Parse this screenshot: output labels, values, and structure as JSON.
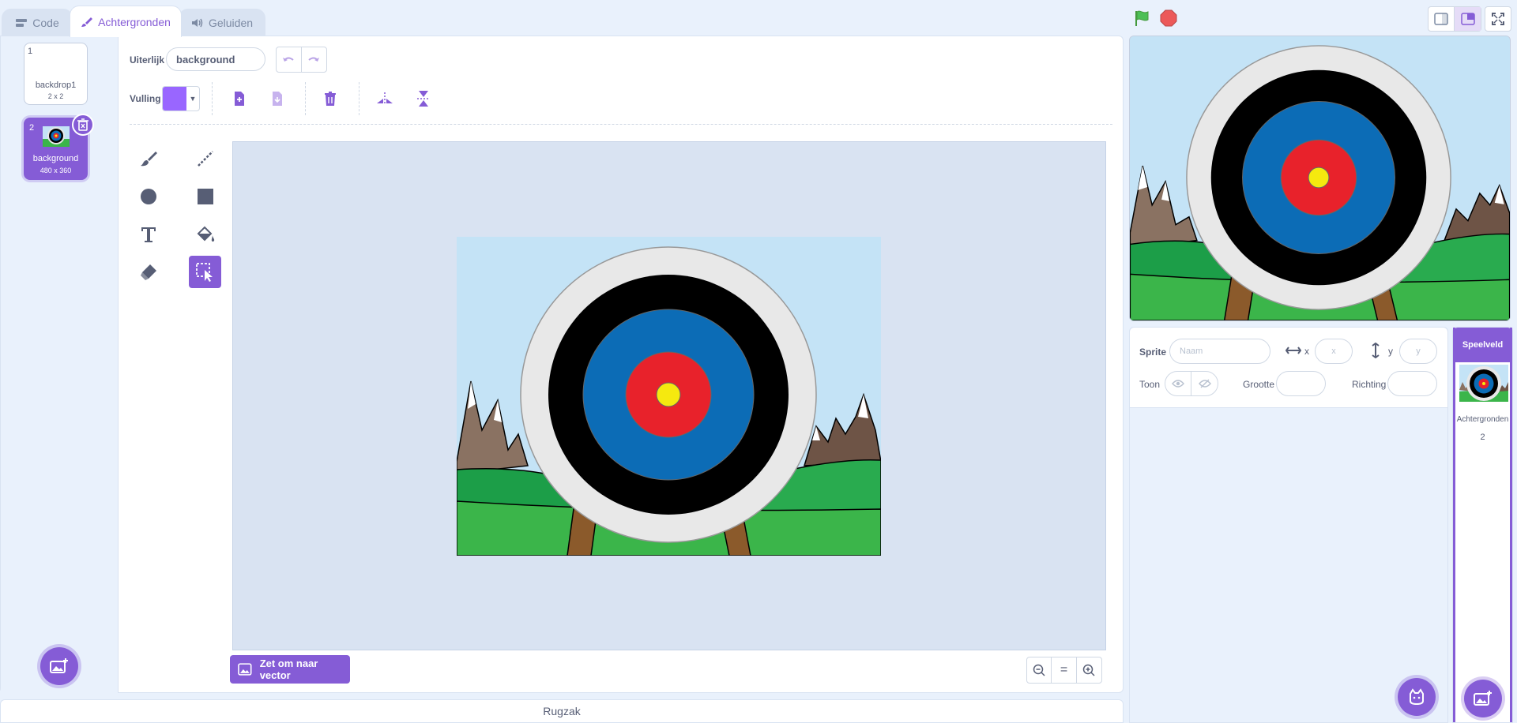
{
  "tabs": [
    {
      "label": "Code",
      "icon": "code-icon"
    },
    {
      "label": "Achtergronden",
      "icon": "brush-icon"
    },
    {
      "label": "Geluiden",
      "icon": "speaker-icon"
    }
  ],
  "header": {
    "green_flag": "green-flag-icon",
    "stop": "stop-icon",
    "layout_buttons": [
      "small-stage-icon",
      "normal-stage-icon",
      "fullscreen-icon"
    ]
  },
  "costumes": [
    {
      "number": "1",
      "name": "backdrop1",
      "size": "2 x 2"
    },
    {
      "number": "2",
      "name": "background",
      "size": "480 x 360"
    }
  ],
  "paint_editor": {
    "costume_label": "Uiterlijk",
    "costume_name": "background",
    "fill_label": "Vulling",
    "fill_color": "#9966ff",
    "convert_button": "Zet om naar vector",
    "zoom_reset": "="
  },
  "sprite_info": {
    "sprite_label": "Sprite",
    "name_placeholder": "Naam",
    "x_label": "x",
    "x_placeholder": "x",
    "y_label": "y",
    "y_placeholder": "y",
    "show_label": "Toon",
    "size_label": "Grootte",
    "direction_label": "Richting"
  },
  "stage_target": {
    "title": "Speelveld",
    "backdrops_label": "Achtergronden",
    "backdrops_count": "2"
  },
  "backpack": {
    "label": "Rugzak"
  },
  "colors": {
    "accent": "#855cd6",
    "flag": "#4cbf56",
    "stop": "#ec5959"
  }
}
